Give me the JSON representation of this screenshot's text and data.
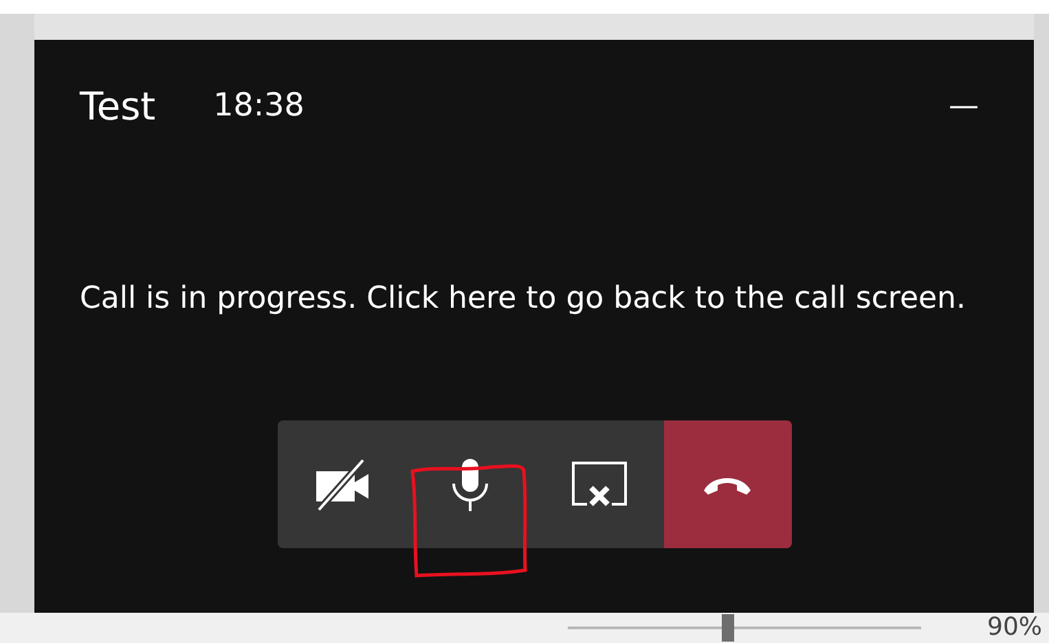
{
  "call_banner": {
    "title": "Test",
    "time": "18:38",
    "minimize": "—",
    "message": "Call is in progress. Click here to go back to the call screen."
  },
  "controls": [
    {
      "kind": "camera-off"
    },
    {
      "kind": "microphone"
    },
    {
      "kind": "stop-share"
    },
    {
      "kind": "hang-up"
    }
  ],
  "status_bar": {
    "zoom": {
      "level": 0.45,
      "reading": "90%"
    }
  }
}
